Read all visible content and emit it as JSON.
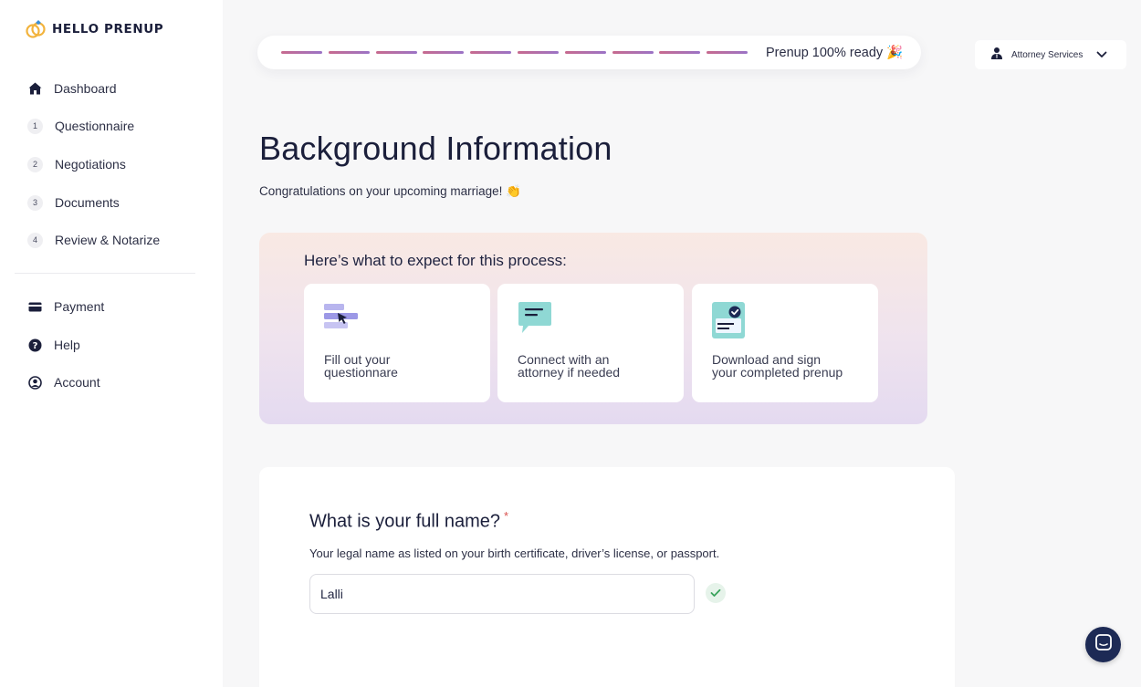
{
  "brand": {
    "name": "HELLO PRENUP"
  },
  "sidebar": {
    "items": [
      {
        "label": "Dashboard",
        "icon": "home-icon"
      },
      {
        "label": "Questionnaire",
        "number": "1"
      },
      {
        "label": "Negotiations",
        "number": "2"
      },
      {
        "label": "Documents",
        "number": "3"
      },
      {
        "label": "Review & Notarize",
        "number": "4"
      }
    ],
    "secondary": [
      {
        "label": "Payment",
        "icon": "credit-card-icon"
      },
      {
        "label": "Help",
        "icon": "help-icon"
      },
      {
        "label": "Account",
        "icon": "account-icon"
      }
    ]
  },
  "progress": {
    "text": "Prenup 100% ready 🎉",
    "segments_total": 10,
    "segments_complete": 10
  },
  "attorney": {
    "label": "Attorney Services"
  },
  "page": {
    "title": "Background Information",
    "subtitle": "Congratulations on your upcoming marriage! 👏"
  },
  "expect": {
    "title": "Here’s what to expect for this process:",
    "cards": [
      {
        "line1": "Fill out your",
        "line2": "questionnare",
        "icon": "questionnaire-list-icon"
      },
      {
        "line1": "Connect with an",
        "line2": "attorney if needed",
        "icon": "chat-bubble-icon"
      },
      {
        "line1": "Download and sign",
        "line2": "your completed prenup",
        "icon": "signed-document-icon"
      }
    ]
  },
  "question": {
    "title": "What is your full name?",
    "required_mark": "*",
    "help": "Your legal name as listed on your birth certificate, driver’s license, or passport.",
    "value": "Lalli"
  },
  "colors": {
    "navy": "#1d2a55",
    "progress_start": "#c76a8e",
    "progress_end": "#9b73c6",
    "check": "#3aa35c"
  }
}
